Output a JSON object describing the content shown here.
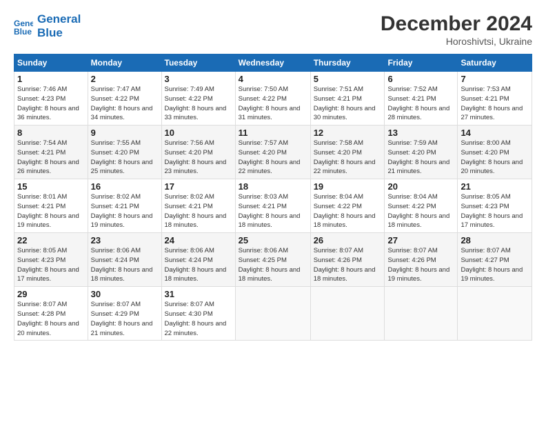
{
  "header": {
    "logo_line1": "General",
    "logo_line2": "Blue",
    "title": "December 2024",
    "subtitle": "Horoshivtsi, Ukraine"
  },
  "columns": [
    "Sunday",
    "Monday",
    "Tuesday",
    "Wednesday",
    "Thursday",
    "Friday",
    "Saturday"
  ],
  "weeks": [
    [
      {
        "day": "1",
        "sunrise": "7:46 AM",
        "sunset": "4:23 PM",
        "daylight": "8 hours and 36 minutes."
      },
      {
        "day": "2",
        "sunrise": "7:47 AM",
        "sunset": "4:22 PM",
        "daylight": "8 hours and 34 minutes."
      },
      {
        "day": "3",
        "sunrise": "7:49 AM",
        "sunset": "4:22 PM",
        "daylight": "8 hours and 33 minutes."
      },
      {
        "day": "4",
        "sunrise": "7:50 AM",
        "sunset": "4:22 PM",
        "daylight": "8 hours and 31 minutes."
      },
      {
        "day": "5",
        "sunrise": "7:51 AM",
        "sunset": "4:21 PM",
        "daylight": "8 hours and 30 minutes."
      },
      {
        "day": "6",
        "sunrise": "7:52 AM",
        "sunset": "4:21 PM",
        "daylight": "8 hours and 28 minutes."
      },
      {
        "day": "7",
        "sunrise": "7:53 AM",
        "sunset": "4:21 PM",
        "daylight": "8 hours and 27 minutes."
      }
    ],
    [
      {
        "day": "8",
        "sunrise": "7:54 AM",
        "sunset": "4:21 PM",
        "daylight": "8 hours and 26 minutes."
      },
      {
        "day": "9",
        "sunrise": "7:55 AM",
        "sunset": "4:20 PM",
        "daylight": "8 hours and 25 minutes."
      },
      {
        "day": "10",
        "sunrise": "7:56 AM",
        "sunset": "4:20 PM",
        "daylight": "8 hours and 23 minutes."
      },
      {
        "day": "11",
        "sunrise": "7:57 AM",
        "sunset": "4:20 PM",
        "daylight": "8 hours and 22 minutes."
      },
      {
        "day": "12",
        "sunrise": "7:58 AM",
        "sunset": "4:20 PM",
        "daylight": "8 hours and 22 minutes."
      },
      {
        "day": "13",
        "sunrise": "7:59 AM",
        "sunset": "4:20 PM",
        "daylight": "8 hours and 21 minutes."
      },
      {
        "day": "14",
        "sunrise": "8:00 AM",
        "sunset": "4:20 PM",
        "daylight": "8 hours and 20 minutes."
      }
    ],
    [
      {
        "day": "15",
        "sunrise": "8:01 AM",
        "sunset": "4:21 PM",
        "daylight": "8 hours and 19 minutes."
      },
      {
        "day": "16",
        "sunrise": "8:02 AM",
        "sunset": "4:21 PM",
        "daylight": "8 hours and 19 minutes."
      },
      {
        "day": "17",
        "sunrise": "8:02 AM",
        "sunset": "4:21 PM",
        "daylight": "8 hours and 18 minutes."
      },
      {
        "day": "18",
        "sunrise": "8:03 AM",
        "sunset": "4:21 PM",
        "daylight": "8 hours and 18 minutes."
      },
      {
        "day": "19",
        "sunrise": "8:04 AM",
        "sunset": "4:22 PM",
        "daylight": "8 hours and 18 minutes."
      },
      {
        "day": "20",
        "sunrise": "8:04 AM",
        "sunset": "4:22 PM",
        "daylight": "8 hours and 18 minutes."
      },
      {
        "day": "21",
        "sunrise": "8:05 AM",
        "sunset": "4:23 PM",
        "daylight": "8 hours and 17 minutes."
      }
    ],
    [
      {
        "day": "22",
        "sunrise": "8:05 AM",
        "sunset": "4:23 PM",
        "daylight": "8 hours and 17 minutes."
      },
      {
        "day": "23",
        "sunrise": "8:06 AM",
        "sunset": "4:24 PM",
        "daylight": "8 hours and 18 minutes."
      },
      {
        "day": "24",
        "sunrise": "8:06 AM",
        "sunset": "4:24 PM",
        "daylight": "8 hours and 18 minutes."
      },
      {
        "day": "25",
        "sunrise": "8:06 AM",
        "sunset": "4:25 PM",
        "daylight": "8 hours and 18 minutes."
      },
      {
        "day": "26",
        "sunrise": "8:07 AM",
        "sunset": "4:26 PM",
        "daylight": "8 hours and 18 minutes."
      },
      {
        "day": "27",
        "sunrise": "8:07 AM",
        "sunset": "4:26 PM",
        "daylight": "8 hours and 19 minutes."
      },
      {
        "day": "28",
        "sunrise": "8:07 AM",
        "sunset": "4:27 PM",
        "daylight": "8 hours and 19 minutes."
      }
    ],
    [
      {
        "day": "29",
        "sunrise": "8:07 AM",
        "sunset": "4:28 PM",
        "daylight": "8 hours and 20 minutes."
      },
      {
        "day": "30",
        "sunrise": "8:07 AM",
        "sunset": "4:29 PM",
        "daylight": "8 hours and 21 minutes."
      },
      {
        "day": "31",
        "sunrise": "8:07 AM",
        "sunset": "4:30 PM",
        "daylight": "8 hours and 22 minutes."
      },
      null,
      null,
      null,
      null
    ]
  ]
}
